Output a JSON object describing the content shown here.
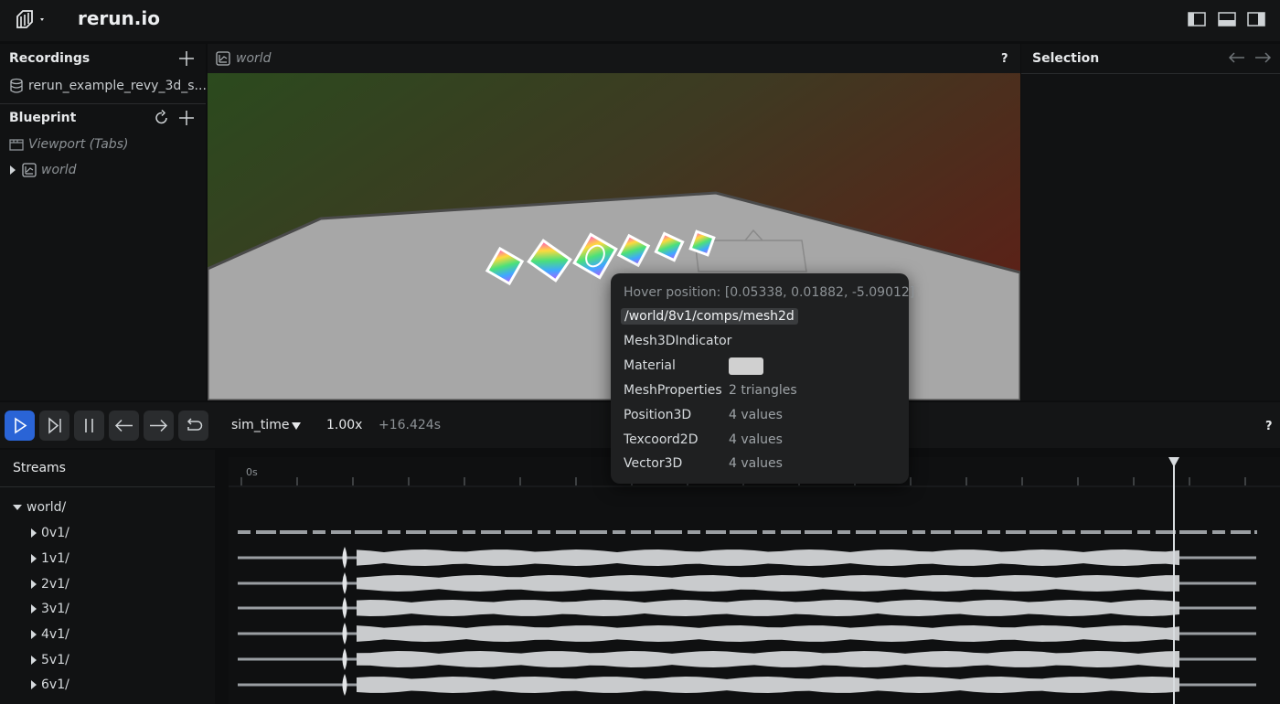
{
  "app": {
    "title": "rerun.io"
  },
  "left": {
    "recordings_header": "Recordings",
    "recording_name": "rerun_example_revy_3d_s...",
    "blueprint_header": "Blueprint",
    "tree": [
      {
        "label": "Viewport (Tabs)"
      },
      {
        "label": "world"
      }
    ]
  },
  "viewport": {
    "tab_title": "world",
    "help": "?"
  },
  "selection": {
    "title": "Selection"
  },
  "timeline": {
    "timeline_name": "sim_time",
    "speed": "1.00x",
    "time_offset": "+16.424s",
    "help": "?",
    "ruler_zero": "0s",
    "playhead_fraction": 0.885
  },
  "streams": {
    "header": "Streams",
    "root": "world/",
    "items": [
      "0v1/",
      "1v1/",
      "2v1/",
      "3v1/",
      "4v1/",
      "5v1/",
      "6v1/"
    ]
  },
  "tooltip": {
    "hover_position": "Hover position: [0.05338, 0.01882, -5.09012]",
    "entity_path": "/world/8v1/comps/mesh2d",
    "rows": [
      {
        "key": "Mesh3DIndicator",
        "value": ""
      },
      {
        "key": "Material",
        "value": ""
      },
      {
        "key": "MeshProperties",
        "value": "2 triangles"
      },
      {
        "key": "Position3D",
        "value": "4 values"
      },
      {
        "key": "Texcoord2D",
        "value": "4 values"
      },
      {
        "key": "Vector3D",
        "value": "4 values"
      }
    ],
    "material_color": "#d0d0d0"
  },
  "colors": {
    "accent": "#2a64d6",
    "bg": "#0d0e0f",
    "panel": "#111213"
  }
}
